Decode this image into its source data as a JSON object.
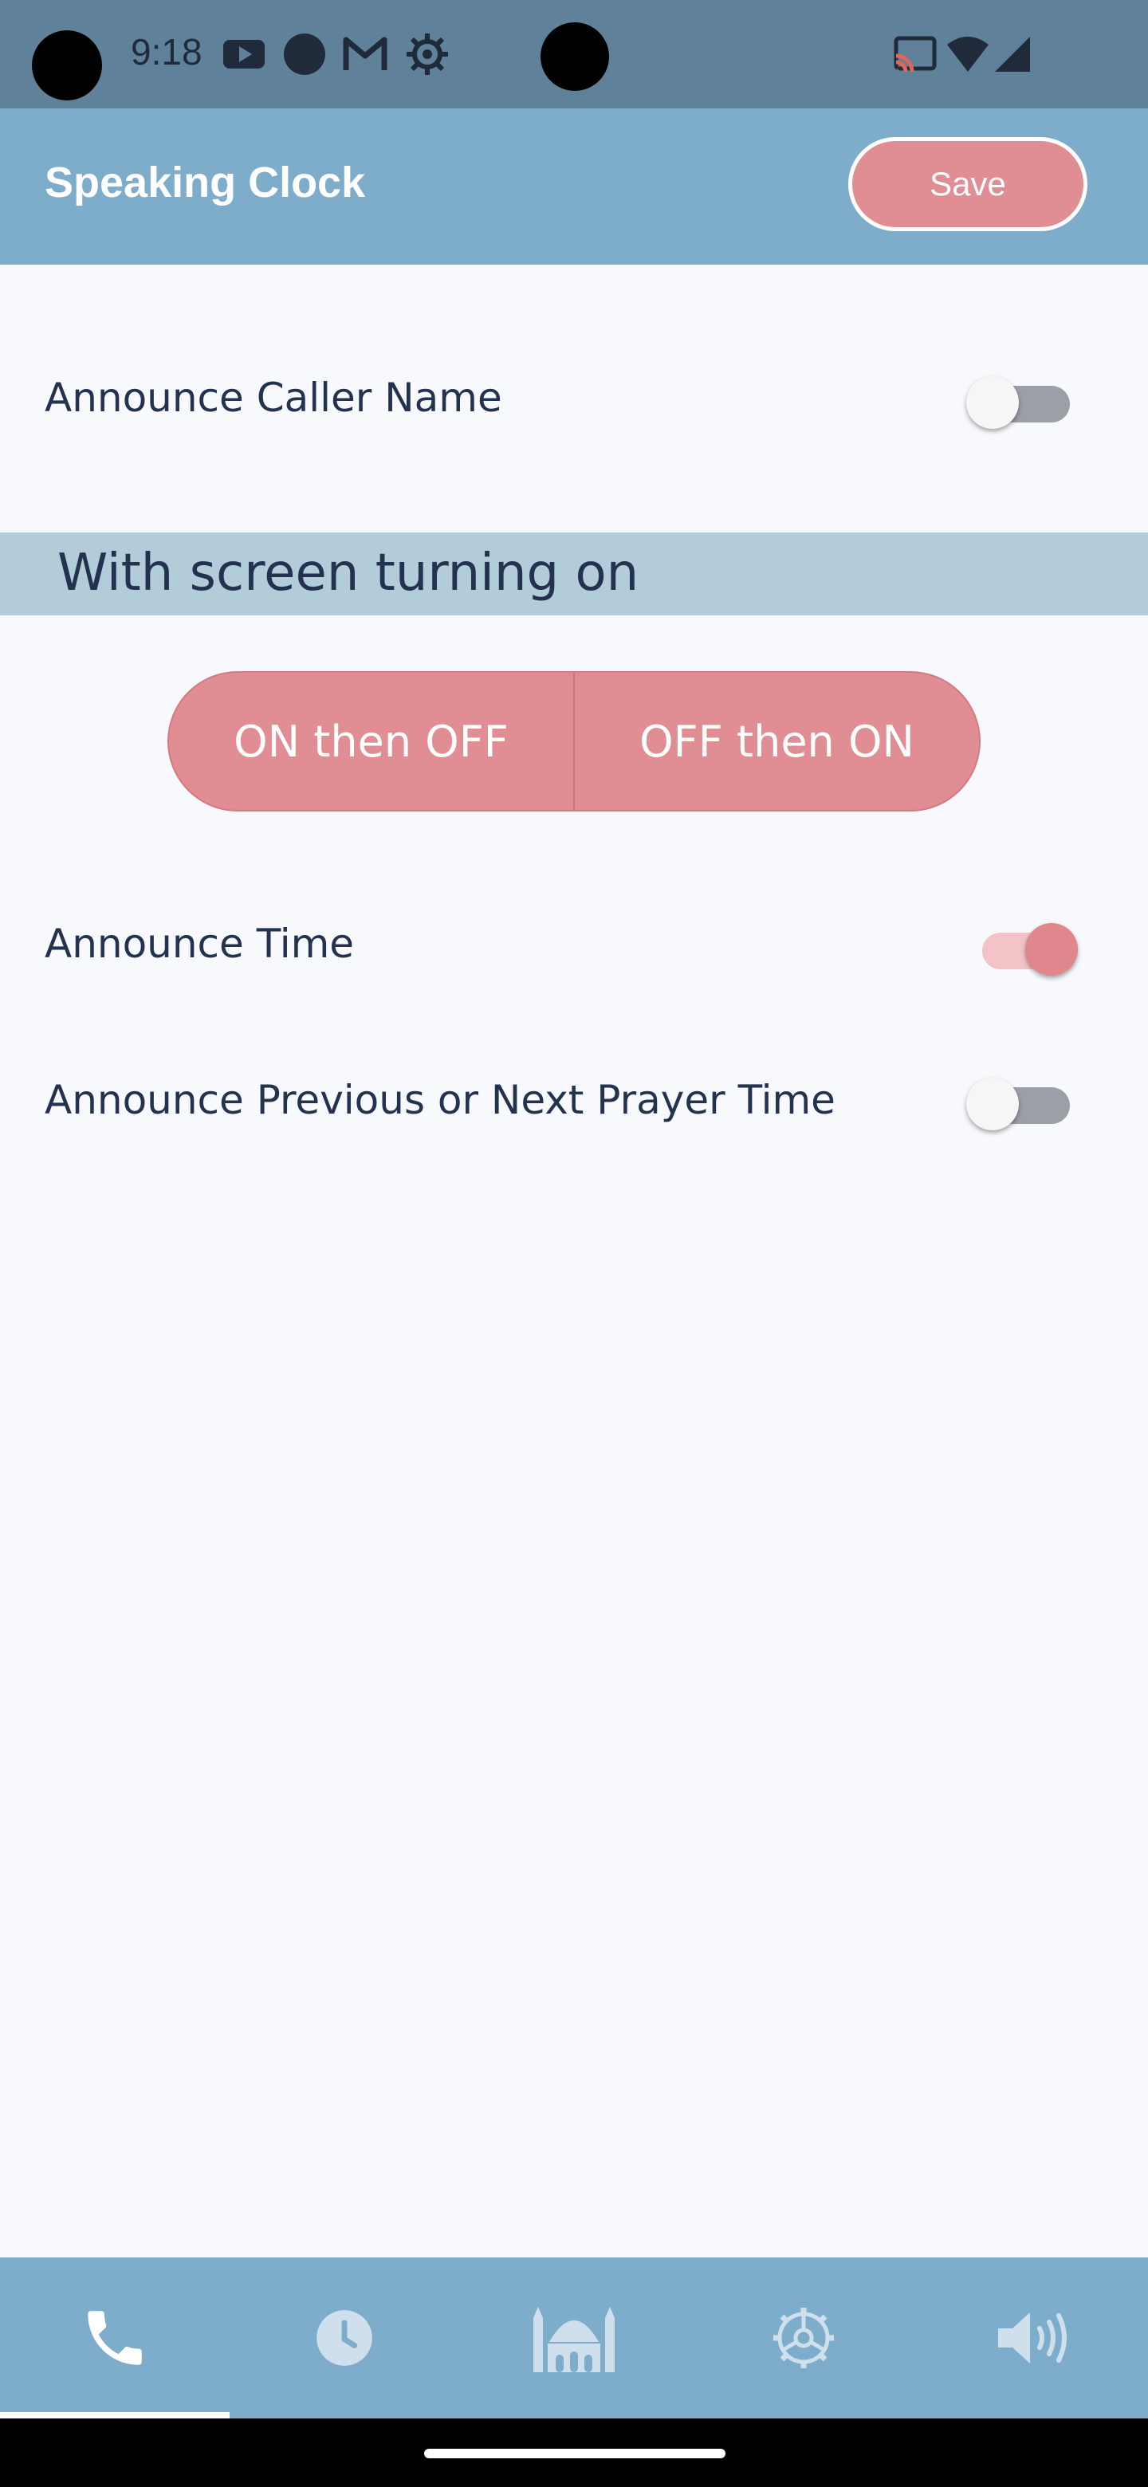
{
  "status_bar": {
    "time": "9:18",
    "left_icons": [
      "youtube-icon",
      "circle-icon",
      "gmail-icon",
      "gear-icon"
    ],
    "right_icons": [
      "cast-icon",
      "wifi-icon",
      "signal-icon"
    ]
  },
  "app_bar": {
    "title": "Speaking Clock",
    "save_label": "Save"
  },
  "settings": {
    "announce_caller_name": {
      "label": "Announce Caller Name",
      "enabled": false
    },
    "section_title": "With screen turning on",
    "segment": {
      "options": [
        "ON then OFF",
        "OFF then ON"
      ]
    },
    "announce_time": {
      "label": "Announce Time",
      "enabled": true
    },
    "announce_prayer_time": {
      "label": "Announce Previous or Next Prayer Time",
      "enabled": false
    }
  },
  "bottom_nav": {
    "items": [
      "phone-icon",
      "clock-icon",
      "mosque-icon",
      "settings-icon",
      "volume-icon"
    ],
    "selected": "phone-icon"
  },
  "colors": {
    "status_bar": "#5f8199",
    "app_bar": "#7eadcc",
    "accent": "#e08e94",
    "section_bg": "#b3ccd9",
    "background": "#f8f9fd",
    "text": "#23324f"
  }
}
